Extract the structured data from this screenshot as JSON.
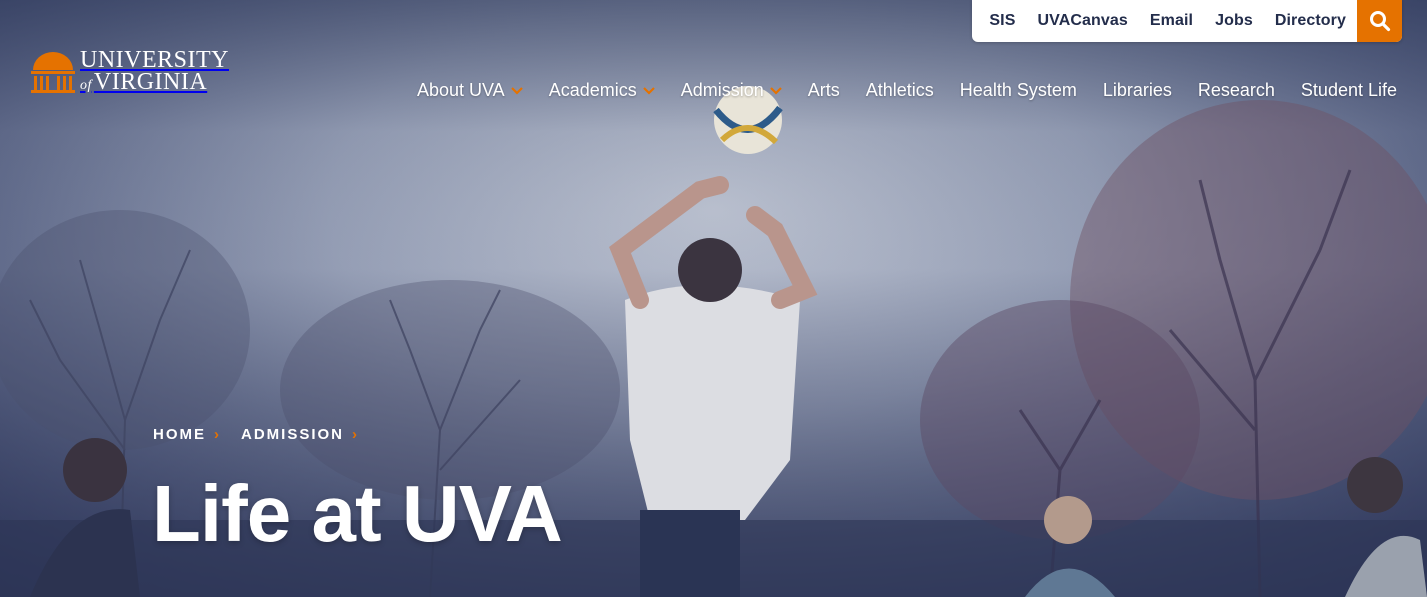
{
  "logo": {
    "line1": "UNIVERSITY",
    "of": "of",
    "line2": "VIRGINIA",
    "accent_color": "#e57200"
  },
  "utility_nav": {
    "items": [
      {
        "label": "SIS"
      },
      {
        "label": "UVACanvas"
      },
      {
        "label": "Email"
      },
      {
        "label": "Jobs"
      },
      {
        "label": "Directory"
      }
    ],
    "search_icon": "search-icon",
    "search_bg": "#e57200"
  },
  "main_nav": {
    "items": [
      {
        "label": "About UVA",
        "has_dropdown": true
      },
      {
        "label": "Academics",
        "has_dropdown": true
      },
      {
        "label": "Admission",
        "has_dropdown": true
      },
      {
        "label": "Arts",
        "has_dropdown": false
      },
      {
        "label": "Athletics",
        "has_dropdown": false
      },
      {
        "label": "Health System",
        "has_dropdown": false
      },
      {
        "label": "Libraries",
        "has_dropdown": false
      },
      {
        "label": "Research",
        "has_dropdown": false
      },
      {
        "label": "Student Life",
        "has_dropdown": false
      }
    ]
  },
  "breadcrumb": {
    "items": [
      {
        "label": "HOME"
      },
      {
        "label": "ADMISSION"
      }
    ],
    "separator_color": "#e57200"
  },
  "page": {
    "title": "Life at UVA"
  },
  "colors": {
    "navy": "#232d4b",
    "orange": "#e57200"
  }
}
